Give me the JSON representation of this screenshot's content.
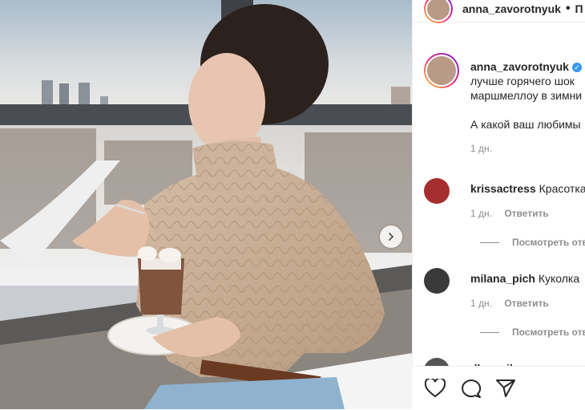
{
  "post": {
    "author": "anna_zavorotnyuk",
    "header_separator": "•",
    "follow_label": "П"
  },
  "caption": {
    "username": "anna_zavorotnyuk",
    "line1": "лучше горячего шок",
    "line2": "маршмеллоу в зимни",
    "line3": "А какой ваш любимы",
    "time": "1 дн."
  },
  "comments": [
    {
      "username": "krissactress",
      "text": "Красотка",
      "time": "1 дн.",
      "reply_label": "Ответить",
      "view_replies": "Посмотреть отве"
    },
    {
      "username": "milana_pich",
      "text": "Куколка",
      "time": "1 дн.",
      "reply_label": "Ответить",
      "view_replies": "Посмотреть отве"
    }
  ],
  "partial_comment": {
    "username": "dleannib"
  },
  "icons": {
    "next": "chevron-right-icon",
    "like": "heart-icon",
    "comment": "comment-bubble-icon",
    "share": "paper-plane-icon",
    "verified": "verified-badge-icon"
  },
  "colors": {
    "text": "#262626",
    "secondary": "#8e8e8e",
    "verified": "#3897f0",
    "sweater": "#c9b19a"
  }
}
